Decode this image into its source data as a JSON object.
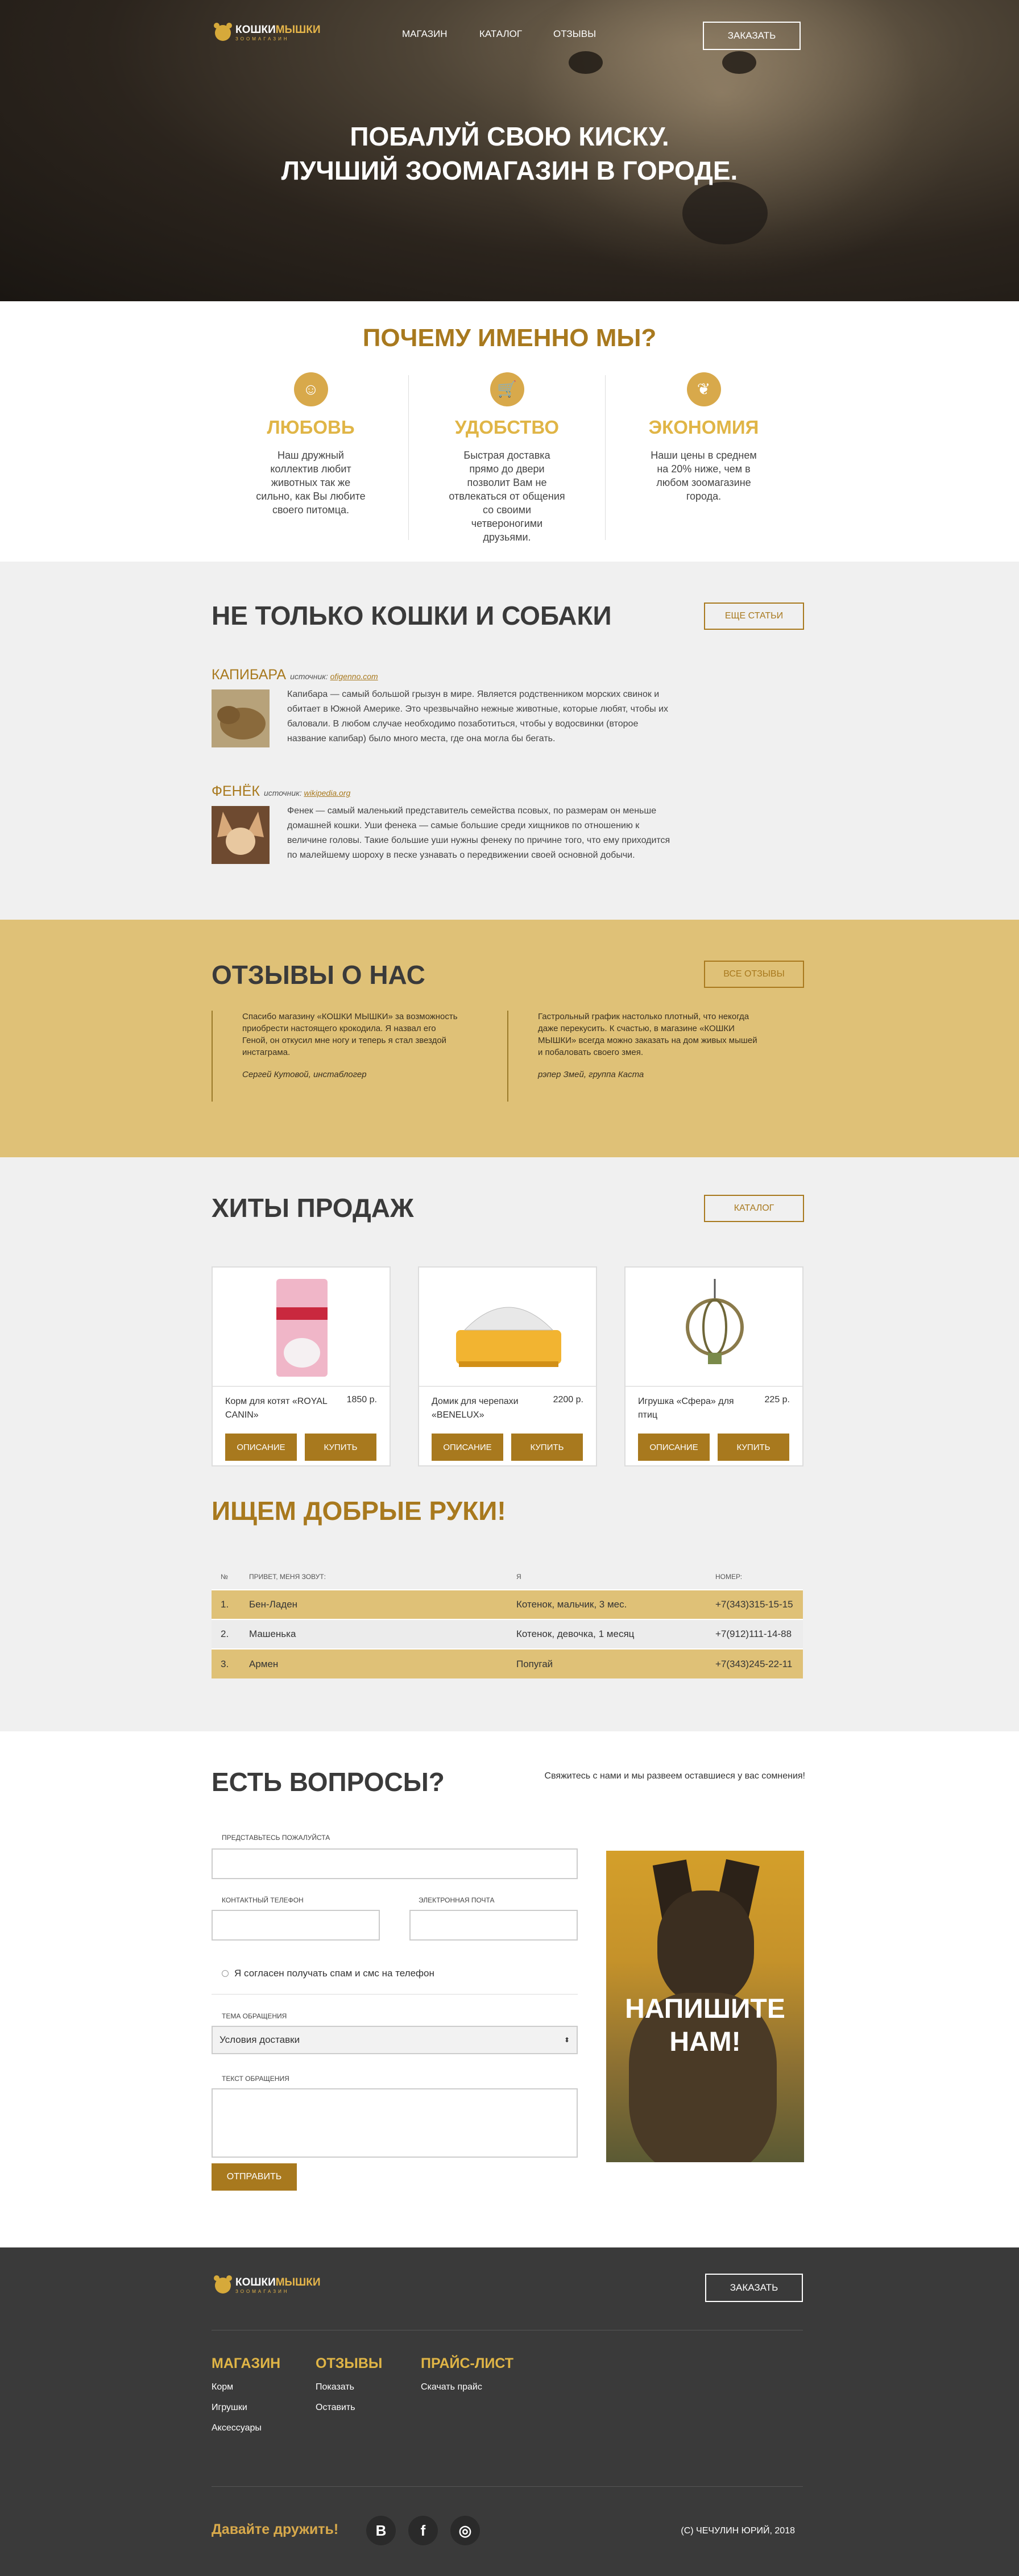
{
  "header": {
    "logo_main": "КОШКИ",
    "logo_accent": "МЫШКИ",
    "logo_sub": "ЗООМАГАЗИН",
    "nav": [
      "МАГАЗИН",
      "КАТАЛОГ",
      "ОТЗЫВЫ"
    ],
    "order_button": "ЗАКАЗАТЬ",
    "hero_line1": "ПОБАЛУЙ СВОЮ КИСКУ.",
    "hero_line2": "ЛУЧШИЙ ЗООМАГАЗИН В ГОРОДЕ."
  },
  "why": {
    "title": "ПОЧЕМУ ИМЕННО МЫ?",
    "features": [
      {
        "icon": "people-icon",
        "title": "ЛЮБОВЬ",
        "text": "Наш дружный коллектив любит животных так же сильно, как Вы любите своего питомца."
      },
      {
        "icon": "cart-icon",
        "title": "УДОБСТВО",
        "text": "Быстрая доставка прямо до двери позволит Вам не отвлекаться от общения со своими четвероногими друзьями."
      },
      {
        "icon": "leaf-icon",
        "title": "ЭКОНОМИЯ",
        "text": "Наши цены в среднем на 20% ниже, чем в любом зоомагазине города."
      }
    ]
  },
  "articles": {
    "title": "НЕ ТОЛЬКО КОШКИ И СОБАКИ",
    "more_button": "ЕЩЕ СТАТЬИ",
    "items": [
      {
        "title": "КАПИБАРА",
        "source_label": "источник:",
        "source": "ofigenno.com",
        "text": "Капибара — самый большой грызун в мире. Является родственником морских свинок и обитает в Южной Америке. Это чрезвычайно нежные животные, которые любят, чтобы их баловали. В любом случае необходимо позаботиться, чтобы у водосвинки (второе название капибар) было много места, где она могла бы бегать."
      },
      {
        "title": "ФЕНЁК",
        "source_label": "источник:",
        "source": "wikipedia.org",
        "text": "Фенек — самый маленький представитель семейства псовых, по размерам он меньше домашней кошки. Уши фенека — самые большие среди хищников по отношению к величине головы. Такие большие уши нужны фенеку по причине того, что ему приходится по малейшему шороху в песке узнавать о передвижении своей основной добычи."
      }
    ]
  },
  "reviews": {
    "title": "ОТЗЫВЫ О НАС",
    "all_button": "ВСЕ ОТЗЫВЫ",
    "items": [
      {
        "text": "Спасибо магазину «КОШКИ МЫШКИ» за возможность приобрести настоящего крокодила. Я назвал его Геной, он откусил мне ногу и теперь я стал звездой инстаграма.",
        "author": "Сергей Кутовой, инстаблогер"
      },
      {
        "text": "Гастрольный график настолько плотный, что некогда даже перекусить. К счастью, в магазине «КОШКИ МЫШКИ» всегда можно заказать на дом живых мышей и побаловать своего змея.",
        "author": "рэпер Змей, группа Каста"
      }
    ]
  },
  "hits": {
    "title": "ХИТЫ ПРОДАЖ",
    "catalog_button": "КАТАЛОГ",
    "products": [
      {
        "name": "Корм для котят «ROYAL CANIN»",
        "price": "1850 р.",
        "desc": "ОПИСАНИЕ",
        "buy": "КУПИТЬ"
      },
      {
        "name": "Домик для черепахи «BENELUX»",
        "price": "2200 р.",
        "desc": "ОПИСАНИЕ",
        "buy": "КУПИТЬ"
      },
      {
        "name": "Игрушка «Сфера» для птиц",
        "price": "225 р.",
        "desc": "ОПИСАНИЕ",
        "buy": "КУПИТЬ"
      }
    ]
  },
  "adopt": {
    "title": "ИЩЕМ ДОБРЫЕ РУКИ!",
    "headers": [
      "№",
      "ПРИВЕТ, МЕНЯ ЗОВУТ:",
      "Я",
      "НОМЕР:"
    ],
    "rows": [
      [
        "1.",
        "Бен-Ладен",
        "Котенок, мальчик, 3 мес.",
        "+7(343)315-15-15"
      ],
      [
        "2.",
        "Машенька",
        "Котенок, девочка, 1 месяц",
        "+7(912)111-14-88"
      ],
      [
        "3.",
        "Армен",
        "Попугай",
        "+7(343)245-22-11"
      ]
    ]
  },
  "contact": {
    "title": "ЕСТЬ ВОПРОСЫ?",
    "subtitle": "Свяжитесь с нами и мы развеем оставшиеся у вас сомнения!",
    "name_label": "ПРЕДСТАВЬТЕСЬ ПОЖАЛУЙСТА",
    "phone_label": "КОНТАКТНЫЙ ТЕЛЕФОН",
    "email_label": "ЭЛЕКТРОННАЯ ПОЧТА",
    "spam_label": "Я согласен получать спам и смс на телефон",
    "topic_label": "ТЕМА ОБРАЩЕНИЯ",
    "topic_value": "Условия доставки",
    "text_label": "ТЕКСТ ОБРАЩЕНИЯ",
    "banner_line1": "НАПИШИТЕ",
    "banner_line2": "НАМ!",
    "send_button": "ОТПРАВИТЬ"
  },
  "footer": {
    "order_button": "ЗАКАЗАТЬ",
    "columns": [
      {
        "title": "МАГАЗИН",
        "links": [
          "Корм",
          "Игрушки",
          "Аксессуары"
        ]
      },
      {
        "title": "ОТЗЫВЫ",
        "links": [
          "Показать",
          "Оставить"
        ]
      },
      {
        "title": "ПРАЙС-ЛИСТ",
        "links": [
          "Скачать прайс"
        ]
      }
    ],
    "friends": "Давайте дружить!",
    "social": [
      "В",
      "f",
      "◎"
    ],
    "copyright": "(С) ЧЕЧУЛИН ЮРИЙ, 2018"
  }
}
